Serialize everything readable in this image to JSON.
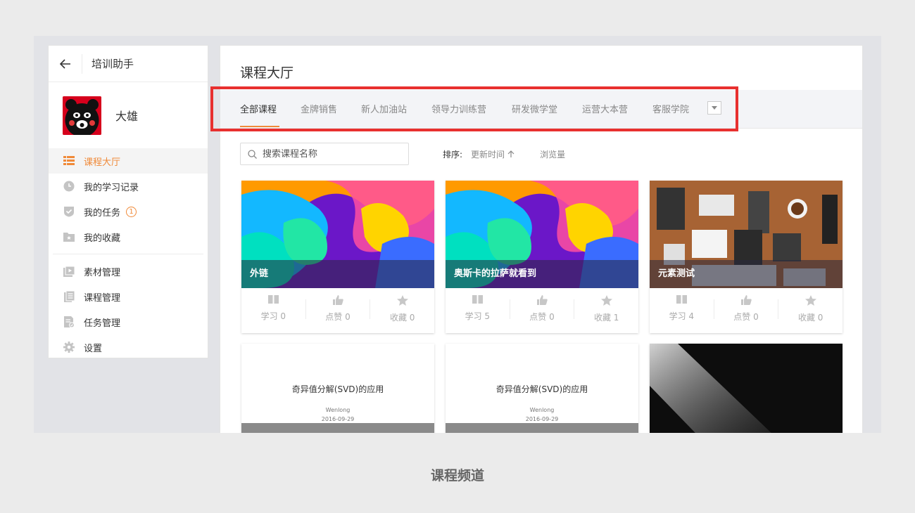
{
  "sidebar": {
    "title": "培训助手",
    "user_name": "大雄",
    "items": [
      {
        "label": "课程大厅",
        "icon": "grid-list-icon",
        "active": true
      },
      {
        "label": "我的学习记录",
        "icon": "clock-icon"
      },
      {
        "label": "我的任务",
        "icon": "shield-check-icon",
        "badge": "1"
      },
      {
        "label": "我的收藏",
        "icon": "folder-star-icon"
      },
      {
        "label": "素材管理",
        "icon": "media-icon"
      },
      {
        "label": "课程管理",
        "icon": "document-list-icon"
      },
      {
        "label": "任务管理",
        "icon": "task-doc-icon"
      },
      {
        "label": "设置",
        "icon": "gear-icon"
      }
    ]
  },
  "main": {
    "title": "课程大厅",
    "tabs": [
      "全部课程",
      "金牌销售",
      "新人加油站",
      "领导力训练营",
      "研发微学堂",
      "运营大本营",
      "客服学院"
    ],
    "search": {
      "placeholder": "搜索课程名称"
    },
    "sort": {
      "label": "排序:",
      "option1": "更新时间",
      "option2": "浏览量"
    },
    "cards": [
      {
        "title": "外链",
        "study": "学习 0",
        "like": "点赞 0",
        "fav": "收藏 0"
      },
      {
        "title": "奥斯卡的拉萨就看到",
        "study": "学习 5",
        "like": "点赞 0",
        "fav": "收藏 1"
      },
      {
        "title": "元素测试",
        "study": "学习 4",
        "like": "点赞 0",
        "fav": "收藏 0"
      },
      {
        "doc_title": "奇异值分解(SVD)的应用",
        "author": "Wenlong",
        "date": "2016-09-29"
      },
      {
        "doc_title": "奇异值分解(SVD)的应用",
        "author": "Wenlong",
        "date": "2016-09-29"
      },
      {
        "title": ""
      }
    ]
  },
  "caption": "课程频道",
  "colors": {
    "accent": "#f08a39",
    "highlight": "#e8302f"
  }
}
